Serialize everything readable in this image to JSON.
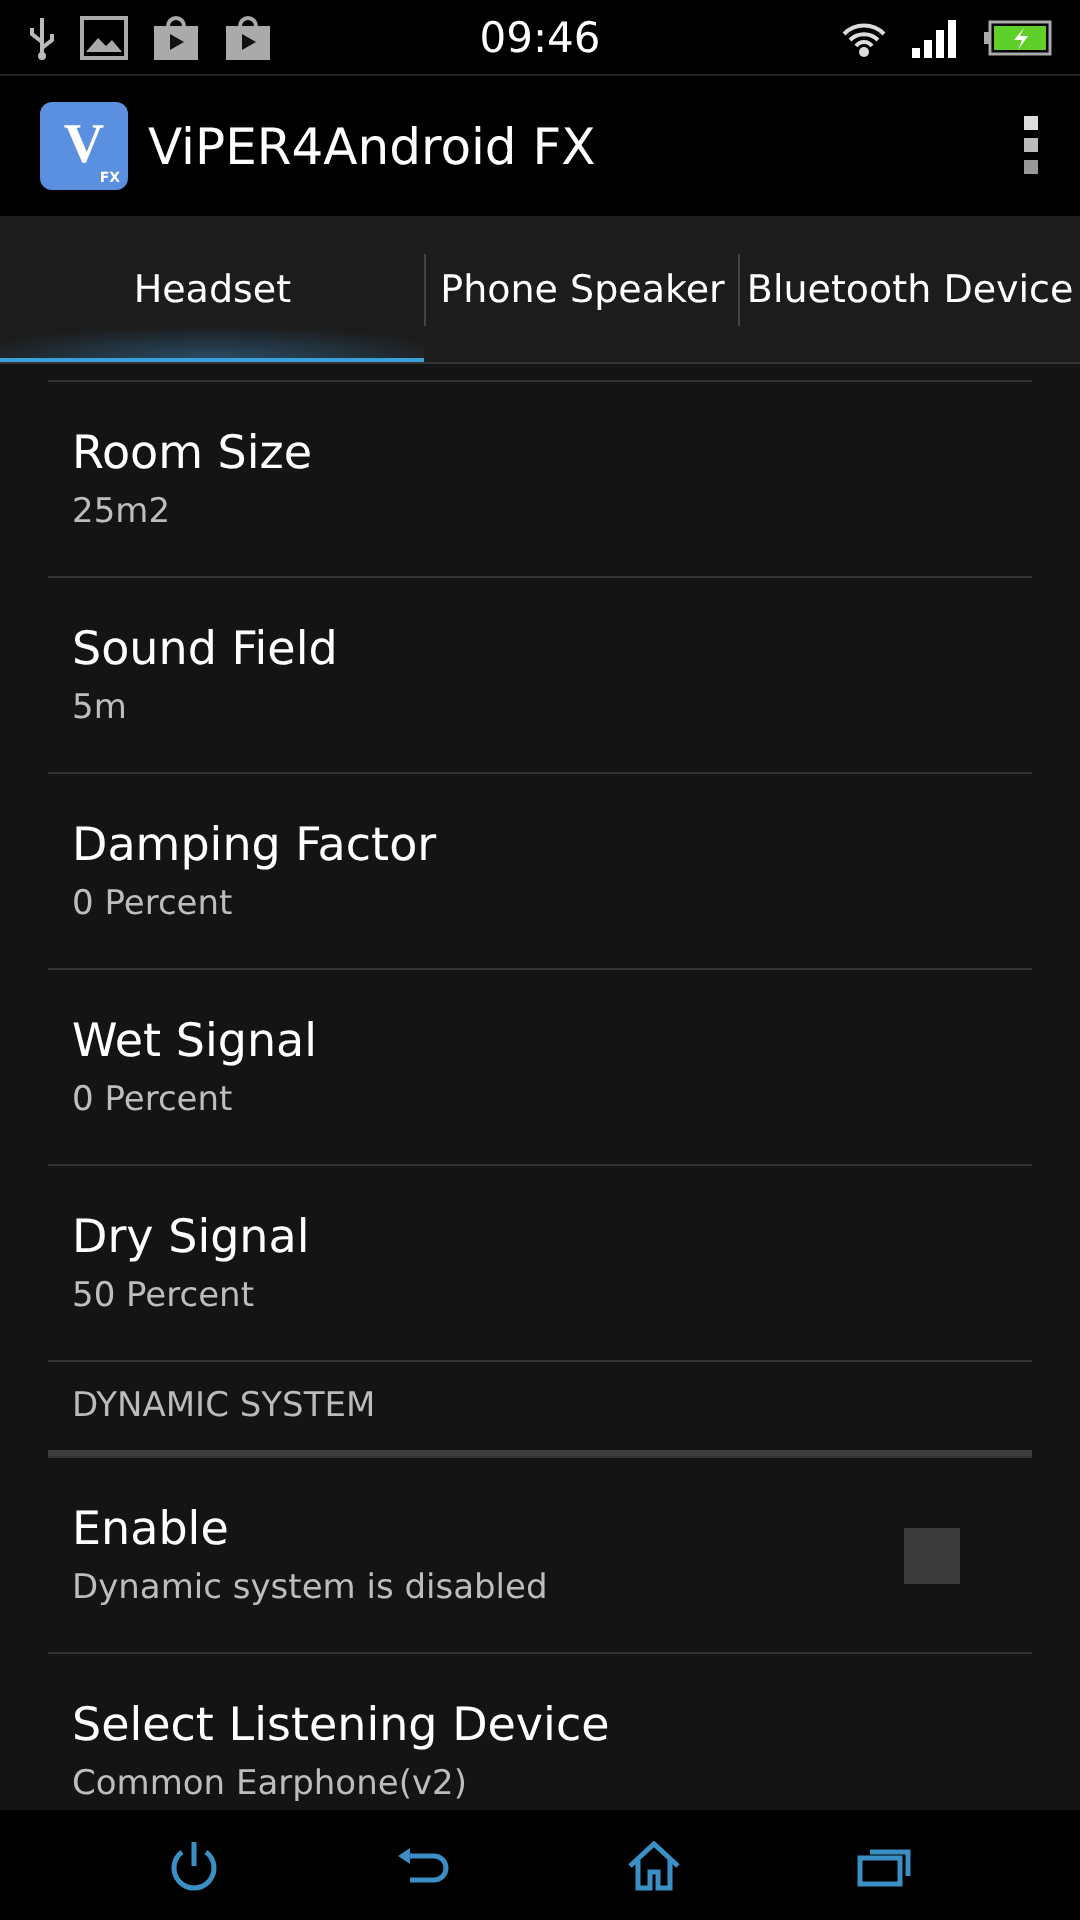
{
  "status_bar": {
    "time": "09:46"
  },
  "app_bar": {
    "title": "ViPER4Android FX",
    "logo_text": "V",
    "logo_sub": "FX"
  },
  "tabs": [
    {
      "label": "Headset",
      "selected": true
    },
    {
      "label": "Phone Speaker",
      "selected": false
    },
    {
      "label": "Bluetooth Device",
      "selected": false
    }
  ],
  "items": [
    {
      "kind": "value",
      "title": "Room Size",
      "summary": "25m2"
    },
    {
      "kind": "value",
      "title": "Sound Field",
      "summary": "5m"
    },
    {
      "kind": "value",
      "title": "Damping Factor",
      "summary": "0 Percent"
    },
    {
      "kind": "value",
      "title": "Wet Signal",
      "summary": "0 Percent"
    },
    {
      "kind": "value",
      "title": "Dry Signal",
      "summary": "50 Percent"
    },
    {
      "kind": "header",
      "title": "DYNAMIC SYSTEM"
    },
    {
      "kind": "checkbox",
      "title": "Enable",
      "summary": "Dynamic system is disabled",
      "checked": false
    },
    {
      "kind": "value",
      "title": "Select Listening Device",
      "summary": "Common Earphone(v2)"
    }
  ]
}
